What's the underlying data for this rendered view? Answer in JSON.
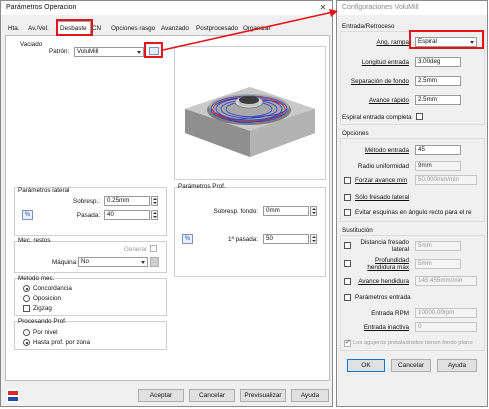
{
  "main": {
    "title": "Parámetros Operacion",
    "tabs": [
      "Hta.",
      "Av./Vel.",
      "Desbaste",
      "CN",
      "Opciones rasgo",
      "Avanzado",
      "Postprocesado",
      "Organizar"
    ],
    "vaciado": {
      "label": "Vaciado",
      "patron_label": "Patrón:",
      "patron_value": "VoluMill"
    },
    "lateral": {
      "label": "Parámetros lateral",
      "sobresp_label": "Sobresp.:",
      "sobresp_value": "0.25mm",
      "pasada_label": "Pasada:",
      "pasada_value": "40",
      "pct_icon": "%"
    },
    "mec_restos": {
      "label": "Mec. restos",
      "generar_label": "Generar",
      "maquina_label": "Máquina:",
      "maquina_value": "No"
    },
    "metodo": {
      "label": "Metodo mec.",
      "options": [
        "Concordancia",
        "Oposicion",
        "Zigzag"
      ]
    },
    "procesando": {
      "label": "Procesando Prof.",
      "options": [
        "Por nivel",
        "Hasta prof. por zona"
      ]
    },
    "prof": {
      "label": "Parámetros Prof.",
      "sobresp_fondo_label": "Sobresp. fondo:",
      "sobresp_fondo_value": "0mm",
      "primera_pasada_label": "1ª pasada:",
      "primera_pasada_value": "50",
      "pct_icon": "%"
    },
    "buttons": {
      "aceptar": "Aceptar",
      "cancelar": "Cancelar",
      "previsualizar": "Previsualizar",
      "ayuda": "Ayuda"
    }
  },
  "config": {
    "title": "Configuraciones VoluMill",
    "entrada": {
      "label": "Entrada/Retroceso",
      "ang_rampa_label": "Ang. rampa",
      "ang_rampa_value": "Espiral",
      "longitud_label": "Longitud entrada",
      "longitud_value": "3.00deg",
      "separacion_label": "Separación de fondo",
      "separacion_value": "2.5mm",
      "avance_label": "Avance rápido",
      "avance_value": "2.5mm",
      "espiral_label": "Espiral entrada completa"
    },
    "opciones": {
      "label": "Opciones",
      "metodo_label": "Método entrada",
      "metodo_value": "45",
      "radio_label": "Radio uniformidad",
      "radio_value": "9mm",
      "forzar_label": "Forzar avance min",
      "forzar_value": "50.000mm/min",
      "solo_label": "Sólo fresado lateral",
      "evitar_label": "Evitar esquinas en ángulo recto para el re"
    },
    "sustitucion": {
      "label": "Sustitución",
      "distancia_label": "Distancia fresado lateral",
      "distancia_value": "5mm",
      "profundidad_label": "Profundidad hendidura máx",
      "profundidad_value": "5mm",
      "avance_hend_label": "Avance hendidura",
      "avance_hend_value": "145.455mm/min",
      "param_entrada_label": "Parámetros entrada",
      "entrada_rpm_label": "Entrada RPM",
      "entrada_rpm_value": "10000.00rpm",
      "entrada_inactiva_label": "Entrada inactiva",
      "entrada_inactiva_value": "0",
      "agujeros_label": "Los agujeros pretaladrados tienen fondo plano"
    },
    "buttons": {
      "ok": "OK",
      "cancelar": "Cancelar",
      "ayuda": "Ayuda"
    }
  },
  "colors": {
    "highlight": "#e3141c",
    "toolpath": "#2b3fc8"
  }
}
